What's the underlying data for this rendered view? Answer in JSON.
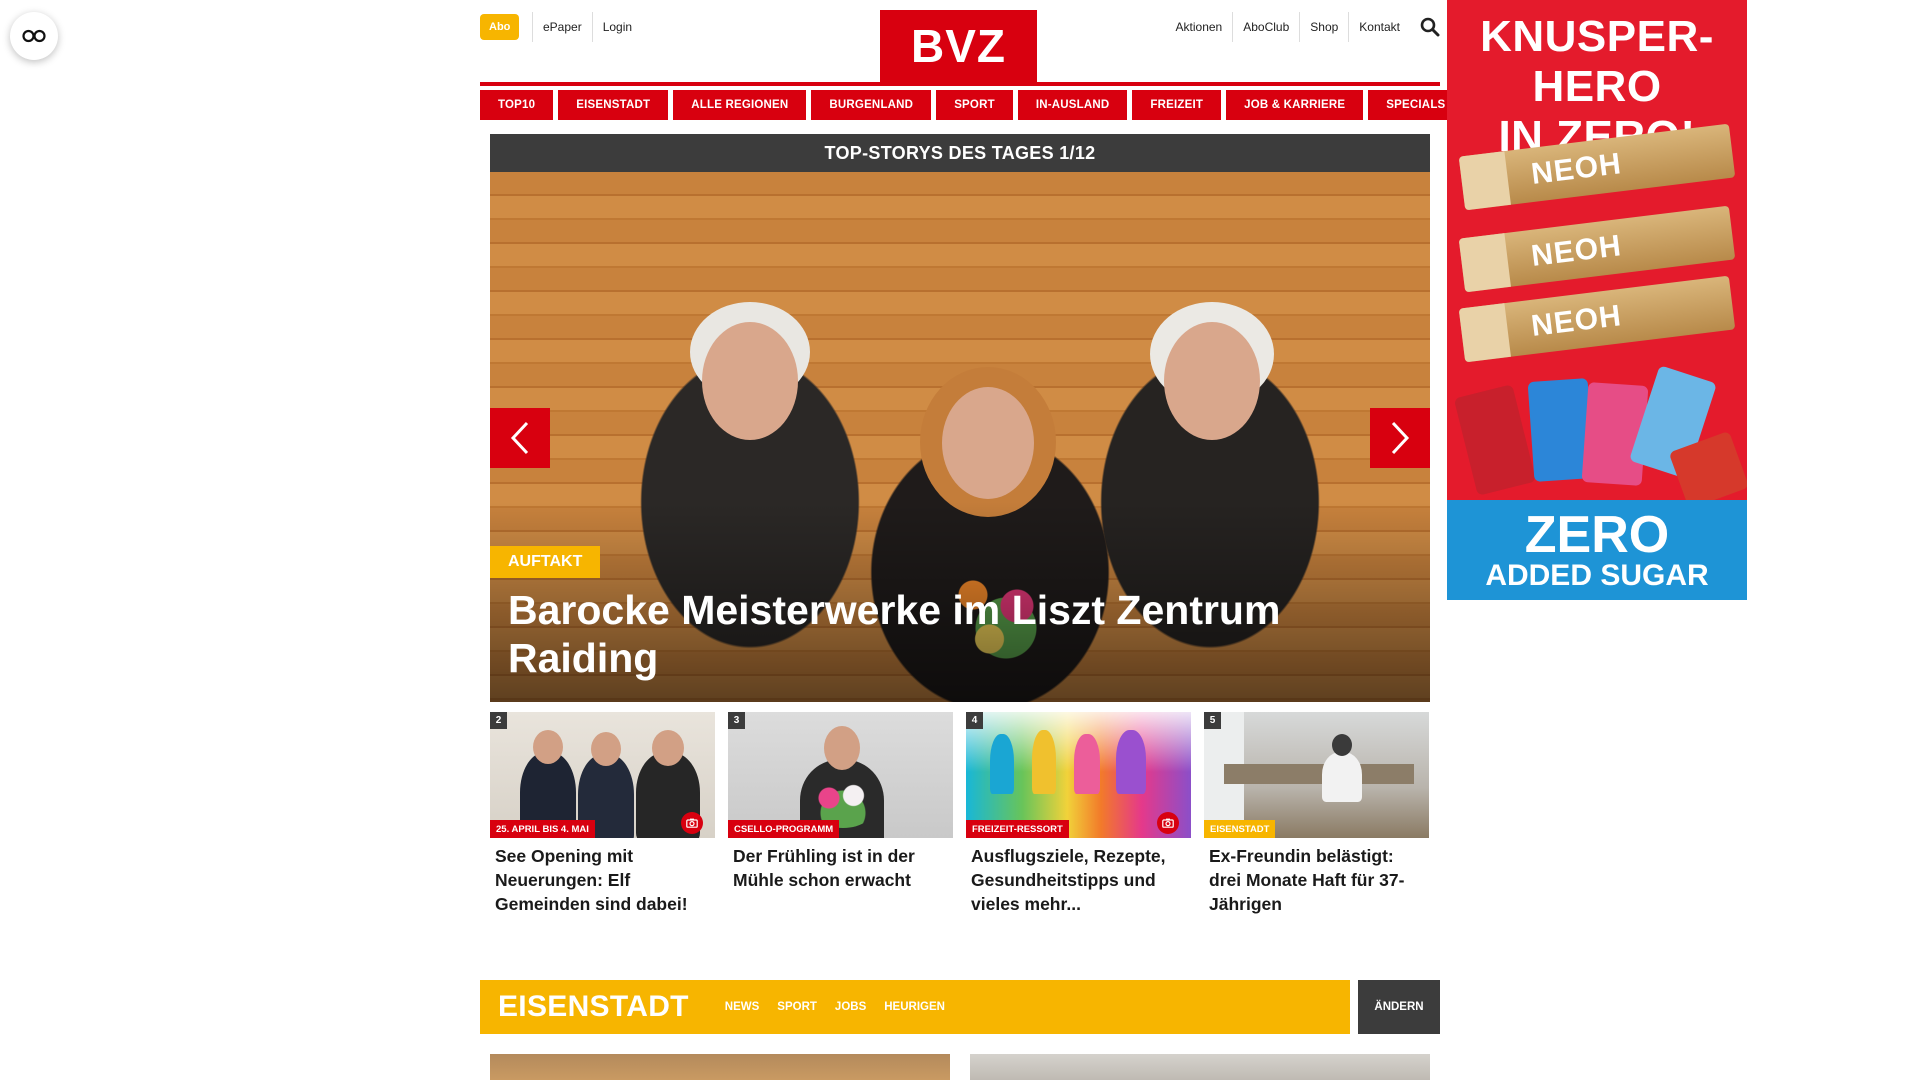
{
  "accessibility": {
    "icon": "glasses-icon"
  },
  "topbar": {
    "abo_label": "Abo",
    "left_links": [
      "ePaper",
      "Login"
    ],
    "logo_text": "BVZ",
    "right_links": [
      "Aktionen",
      "AboClub",
      "Shop",
      "Kontakt"
    ],
    "search_icon": "search-icon"
  },
  "nav": {
    "items": [
      "TOP10",
      "EISENSTADT",
      "ALLE REGIONEN",
      "BURGENLAND",
      "SPORT",
      "IN-AUSLAND",
      "FREIZEIT",
      "JOB & KARRIERE",
      "SPECIALS"
    ]
  },
  "carousel": {
    "header": "TOP-STORYS DES TAGES 1/12",
    "hero_tag": "AUFTAKT",
    "hero_title": "Barocke Meisterwerke im Liszt Zentrum Raiding",
    "prev_icon": "chevron-left-icon",
    "next_icon": "chevron-right-icon"
  },
  "cards": [
    {
      "num": "2",
      "tag": "25. APRIL BIS 4. MAI",
      "tag_color": "#d8000f",
      "title": "See Opening mit Neuerungen: Elf Gemeinden sind dabei!",
      "has_gallery": true
    },
    {
      "num": "3",
      "tag": "CSELLO-PROGRAMM",
      "tag_color": "#d8000f",
      "title": "Der Frühling ist in der Mühle schon erwacht",
      "has_gallery": false
    },
    {
      "num": "4",
      "tag": "FREIZEIT-RESSORT",
      "tag_color": "#d8000f",
      "title": "Ausflugsziele, Rezepte, Gesundheitstipps und vieles mehr...",
      "has_gallery": true
    },
    {
      "num": "5",
      "tag": "EISENSTADT",
      "tag_color": "#f7b500",
      "title": "Ex-Freundin belästigt: drei Monate Haft für 37-Jährigen",
      "has_gallery": false
    }
  ],
  "region": {
    "title": "EISENSTADT",
    "links": [
      "NEWS",
      "SPORT",
      "JOBS",
      "HEURIGEN"
    ],
    "change_label": "ÄNDERN"
  },
  "ad": {
    "headline_1": "KNUSPER-HERO",
    "headline_2": "IN ZERO!",
    "bar_label": "NEOH",
    "bottom_1": "ZERO",
    "bottom_2": "ADDED SUGAR"
  },
  "colors": {
    "brand_red": "#d8000f",
    "accent_yellow": "#f7b500",
    "dark_grey": "#3c3c3c"
  }
}
